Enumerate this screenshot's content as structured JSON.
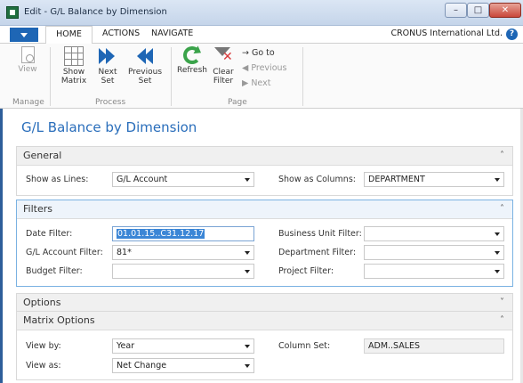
{
  "window": {
    "title": "Edit - G/L Balance by Dimension",
    "min_glyph": "–",
    "max_glyph": "□",
    "close_glyph": "✕"
  },
  "ribbon_tabs": {
    "home": "HOME",
    "actions": "ACTIONS",
    "navigate": "NAVIGATE"
  },
  "company": "CRONUS International Ltd.",
  "help_glyph": "?",
  "ribbon": {
    "manage": {
      "label": "Manage",
      "view": "View"
    },
    "process": {
      "label": "Process",
      "show_matrix_1": "Show",
      "show_matrix_2": "Matrix",
      "next_set_1": "Next",
      "next_set_2": "Set",
      "previous_set_1": "Previous",
      "previous_set_2": "Set"
    },
    "page": {
      "label": "Page",
      "refresh": "Refresh",
      "clear_filter_1": "Clear",
      "clear_filter_2": "Filter",
      "go_to": "→ Go to",
      "previous": "◀ Previous",
      "next": "▶ Next"
    }
  },
  "page_title": "G/L Balance by Dimension",
  "general": {
    "header": "General",
    "show_as_lines_label": "Show as Lines:",
    "show_as_lines_value": "G/L Account",
    "show_as_columns_label": "Show as Columns:",
    "show_as_columns_value": "DEPARTMENT"
  },
  "filters": {
    "header": "Filters",
    "date_filter_label": "Date Filter:",
    "date_filter_value": "01.01.15..C31.12.17",
    "gl_account_filter_label": "G/L Account Filter:",
    "gl_account_filter_value": "81*",
    "budget_filter_label": "Budget Filter:",
    "budget_filter_value": "",
    "business_unit_filter_label": "Business Unit Filter:",
    "business_unit_filter_value": "",
    "department_filter_label": "Department Filter:",
    "department_filter_value": "",
    "project_filter_label": "Project Filter:",
    "project_filter_value": ""
  },
  "options": {
    "header": "Options"
  },
  "matrix_options": {
    "header": "Matrix Options",
    "view_by_label": "View by:",
    "view_by_value": "Year",
    "view_as_label": "View as:",
    "view_as_value": "Net Change",
    "column_set_label": "Column Set:",
    "column_set_value": "ADM..SALES"
  },
  "colors": {
    "accent": "#1e66b5",
    "title_blue": "#2a6ebb",
    "refresh_green": "#3aa34a",
    "clear_red": "#d8383a"
  },
  "icons": {
    "view": "view-icon",
    "show_matrix": "matrix-icon",
    "next_set": "double-chevron-right-icon",
    "previous_set": "double-chevron-left-icon",
    "refresh": "refresh-icon",
    "clear_filter": "clear-filter-icon",
    "collapse": "chevron-up-icon",
    "expand": "chevron-down-icon"
  }
}
